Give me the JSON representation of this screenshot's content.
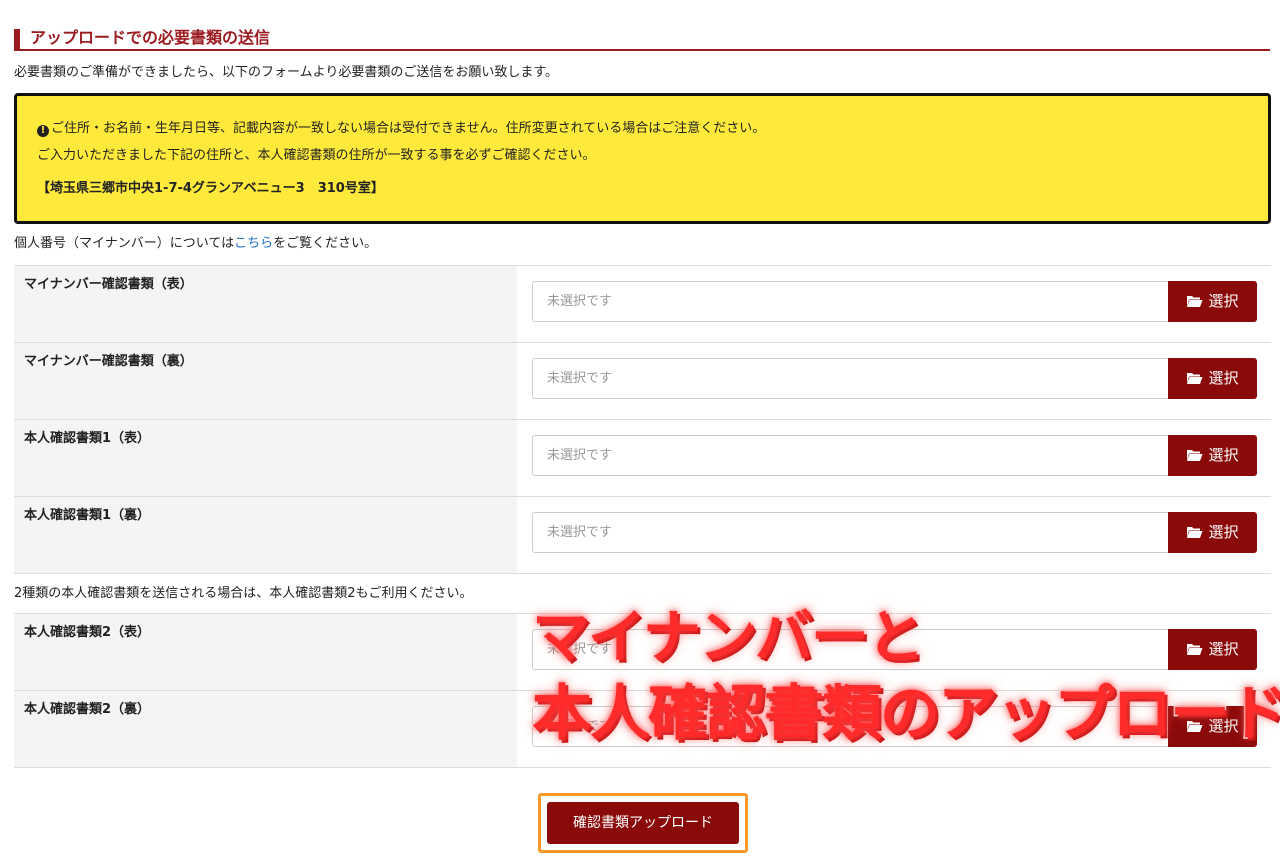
{
  "section": {
    "title": "アップロードでの必要書類の送信"
  },
  "intro": "必要書類のご準備ができましたら、以下のフォームより必要書類のご送信をお願い致します。",
  "notice": {
    "line1": "ご住所・お名前・生年月日等、記載内容が一致しない場合は受付できません。住所変更されている場合はご注意ください。",
    "line2": "ご入力いただきました下記の住所と、本人確認書類の住所が一致する事を必ずご確認ください。",
    "address": "【埼玉県三郷市中央1-7-4グランアベニュー3　310号室】",
    "alert_icon": "exclamation-circle-icon"
  },
  "mynumber_note": {
    "prefix": "個人番号（マイナンバー）については",
    "link": "こちら",
    "suffix": "をご覧ください。"
  },
  "upload_rows_1": [
    {
      "label": "マイナンバー確認書類（表）",
      "placeholder": "未選択です",
      "button": "選択"
    },
    {
      "label": "マイナンバー確認書類（裏）",
      "placeholder": "未選択です",
      "button": "選択"
    },
    {
      "label": "本人確認書類1（表）",
      "placeholder": "未選択です",
      "button": "選択"
    },
    {
      "label": "本人確認書類1（裏）",
      "placeholder": "未選択です",
      "button": "選択"
    }
  ],
  "note2": "2種類の本人確認書類を送信される場合は、本人確認書類2もご利用ください。",
  "upload_rows_2": [
    {
      "label": "本人確認書類2（表）",
      "placeholder": "未選択です",
      "button": "選択"
    },
    {
      "label": "本人確認書類2（裏）",
      "placeholder": "未選択です",
      "button": "選択"
    }
  ],
  "submit": {
    "label": "確認書類アップロード"
  },
  "overlay": {
    "line1": "マイナンバーと",
    "line2": "本人確認書類のアップロード"
  },
  "colors": {
    "brand": "#8a0a0a",
    "header_accent": "#9b1b20",
    "notice_bg": "#ffea3b",
    "highlight_border": "#f39a2a",
    "overlay_text": "#ff2b2b"
  }
}
